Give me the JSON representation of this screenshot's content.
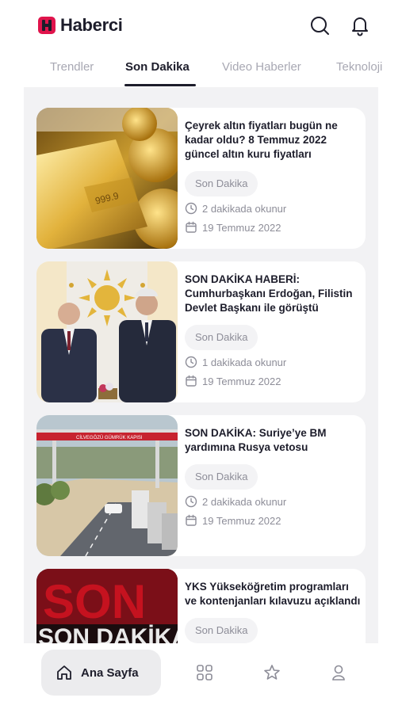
{
  "app": {
    "name": "Haberci"
  },
  "tabs": [
    {
      "label": "Trendler",
      "active": false
    },
    {
      "label": "Son Dakika",
      "active": true
    },
    {
      "label": "Video Haberler",
      "active": false
    },
    {
      "label": "Teknoloji",
      "active": false
    }
  ],
  "articles": [
    {
      "title": "Çeyrek altın fiyatları bugün ne kadar oldu? 8 Temmuz 2022 güncel altın kuru fiyatları",
      "category": "Son Dakika",
      "read_time": "2 dakikada okunur",
      "date": "19 Temmuz 2022"
    },
    {
      "title": "SON DAKİKA HABERİ: Cumhurbaşkanı Erdoğan, Filistin Devlet Başkanı ile görüştü",
      "category": "Son Dakika",
      "read_time": "1 dakikada okunur",
      "date": "19 Temmuz 2022"
    },
    {
      "title": "SON DAKİKA: Suriye’ye BM yardımına Rusya vetosu",
      "category": "Son Dakika",
      "read_time": "2 dakikada okunur",
      "date": "19 Temmuz 2022"
    },
    {
      "title": "YKS Yükseköğretim programları ve kontenjanları kılavuzu açıklandı",
      "category": "Son Dakika"
    }
  ],
  "thumb_text": {
    "border_sign": "CİLVEGÖZÜ GÜMRÜK KAPISI",
    "banner": "SON DAKİKA"
  },
  "bottom_nav": {
    "home_label": "Ana Sayfa"
  },
  "colors": {
    "brand": "#e0144c",
    "text": "#1d1d2b",
    "muted": "#8d8d98",
    "feed_bg": "#f2f2f4"
  }
}
